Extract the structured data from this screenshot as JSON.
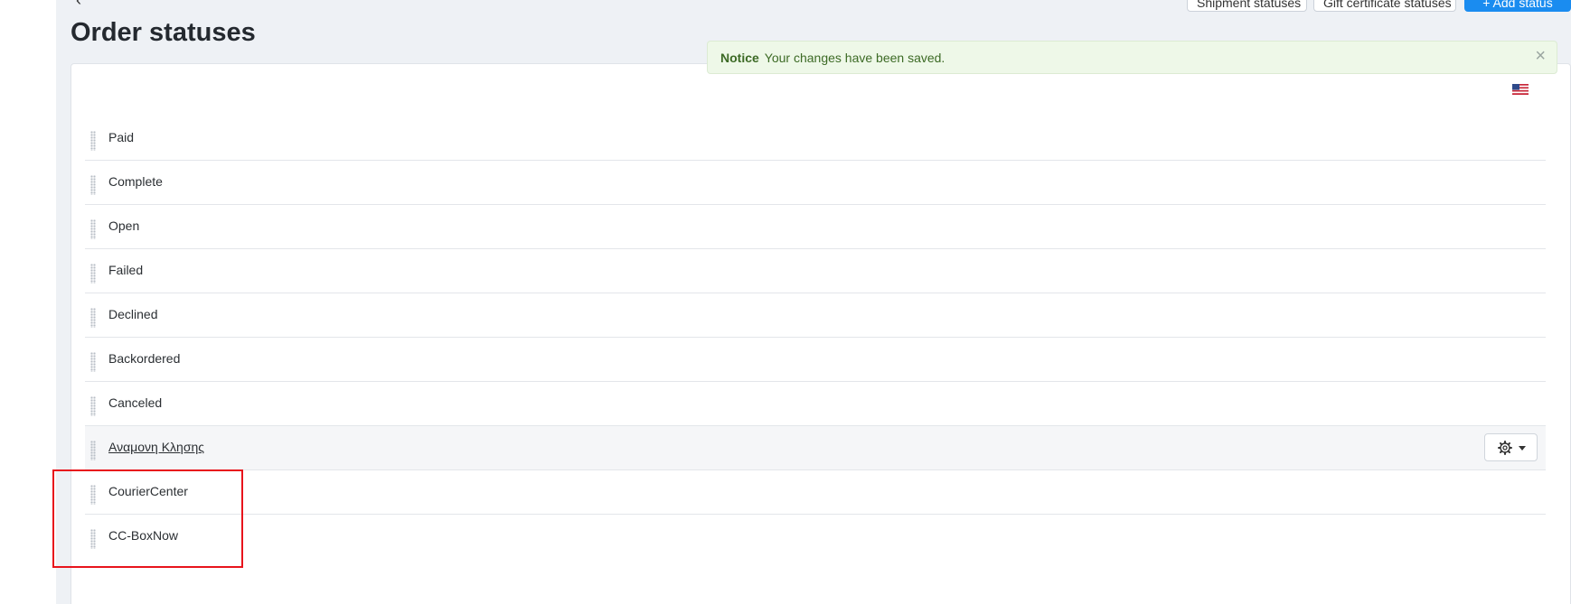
{
  "header": {
    "back_icon": "‹",
    "title": "Order statuses",
    "buttons": {
      "shipment": "Shipment statuses",
      "gift": "Gift certificate statuses",
      "add": "+ Add status"
    }
  },
  "notice": {
    "title": "Notice",
    "message": "Your changes have been saved.",
    "close": "×"
  },
  "language": {
    "icon": "us-flag-icon"
  },
  "statuses": [
    {
      "label": "Paid"
    },
    {
      "label": "Complete"
    },
    {
      "label": "Open"
    },
    {
      "label": "Failed"
    },
    {
      "label": "Declined"
    },
    {
      "label": "Backordered"
    },
    {
      "label": "Canceled"
    },
    {
      "label": "Αναμονη Κλησης"
    },
    {
      "label": "CourierCenter"
    },
    {
      "label": "CC-BoxNow"
    }
  ],
  "colors": {
    "accent": "#1a8cf0",
    "highlight_box": "#e8141c",
    "notice_bg": "#eef8e8"
  }
}
